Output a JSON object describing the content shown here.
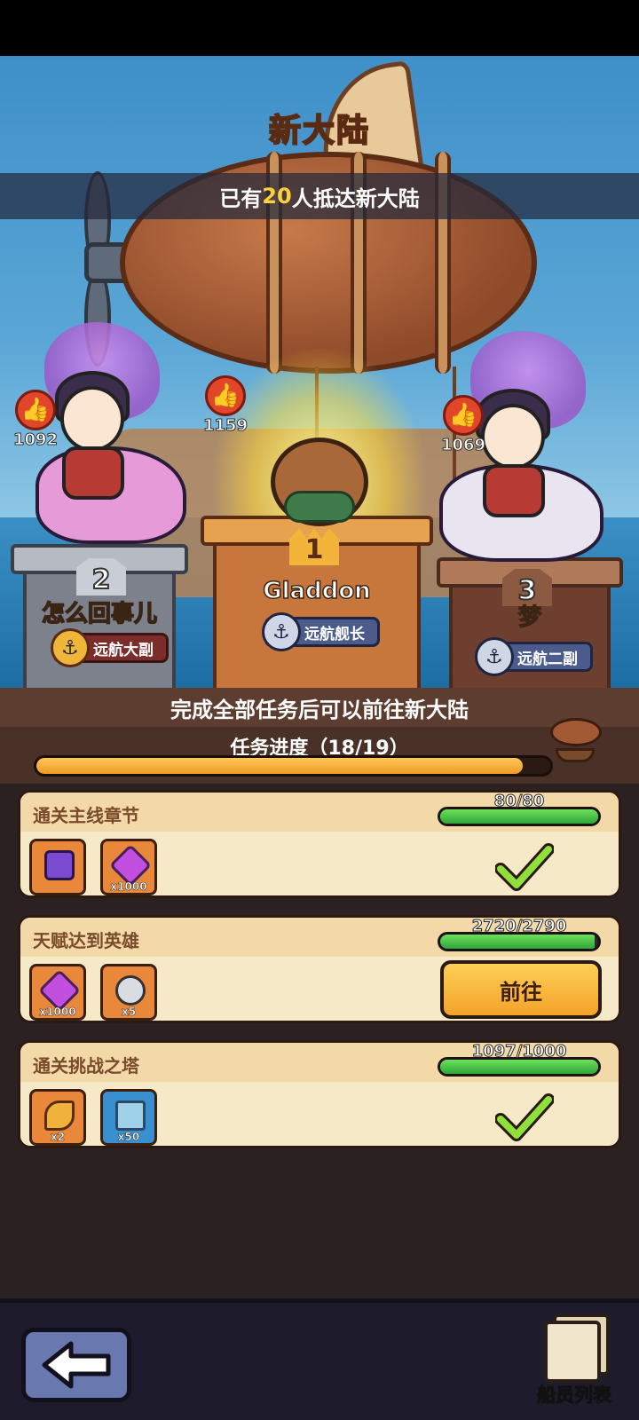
{
  "header": {
    "title": "新大陆",
    "arrived_prefix": "已有",
    "arrived_count": "20",
    "arrived_suffix": "人抵达新大陆"
  },
  "podium": [
    {
      "rank": "1",
      "name": "Gladdon",
      "title": "远航舰长",
      "likes": "1159"
    },
    {
      "rank": "2",
      "name": "怎么回事儿",
      "title": "远航大副",
      "likes": "1092"
    },
    {
      "rank": "3",
      "name": "梦",
      "title": "远航二副",
      "likes": "1069"
    }
  ],
  "progress": {
    "hint": "完成全部任务后可以前往新大陆",
    "label": "任务进度（18/19）",
    "fraction": 0.947
  },
  "tasks": [
    {
      "name": "通关主线章节",
      "progress_text": "80/80",
      "progress_fraction": 1.0,
      "status": "complete",
      "rewards": [
        {
          "icon": "chest-icon",
          "qty": ""
        },
        {
          "icon": "gem-icon",
          "qty": "x1000"
        }
      ]
    },
    {
      "name": "天赋达到英雄",
      "progress_text": "2720/2790",
      "progress_fraction": 0.975,
      "status": "go",
      "button_label": "前往",
      "rewards": [
        {
          "icon": "gem-icon",
          "qty": "x1000"
        },
        {
          "icon": "coin-icon",
          "qty": "x5"
        }
      ]
    },
    {
      "name": "通关挑战之塔",
      "progress_text": "1097/1000",
      "progress_fraction": 1.0,
      "status": "complete",
      "rewards": [
        {
          "icon": "wand-icon",
          "qty": "x2"
        },
        {
          "icon": "scroll-icon",
          "qty": "x50"
        }
      ]
    }
  ],
  "bottom": {
    "back_icon": "arrow-left-icon",
    "crew_label": "船员列表"
  },
  "colors": {
    "progress_fill": "#f3a32a",
    "task_bar_fill": "#2fa53a",
    "go_button": "#ffce55"
  }
}
